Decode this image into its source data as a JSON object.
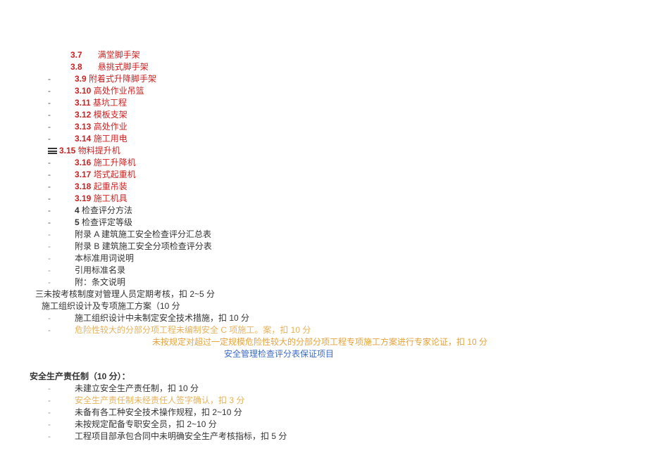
{
  "toc": {
    "r37": {
      "num": "3.7",
      "txt": "满堂脚手架",
      "cls": "red"
    },
    "r38": {
      "num": "3.8",
      "txt": "悬挑式脚手架",
      "cls": "red"
    },
    "r39": {
      "num": "3.9",
      "txt": "附着式升降脚手架",
      "cls": "red"
    },
    "r310": {
      "num": "3.10",
      "txt": "高处作业吊篮",
      "cls": "red"
    },
    "r311": {
      "num": "3.11",
      "txt": "基坑工程",
      "cls": "red"
    },
    "r312": {
      "num": "3.12",
      "txt": "模板支架",
      "cls": "red"
    },
    "r313": {
      "num": "3.13",
      "txt": "高处作业",
      "cls": "red"
    },
    "r314": {
      "num": "3.14",
      "txt": "施工用电",
      "cls": "red"
    },
    "r315": {
      "num": "3.15",
      "txt": "物料提升机",
      "cls": "red"
    },
    "r316": {
      "num": "3.16",
      "txt": "施工升降机",
      "cls": "red"
    },
    "r317": {
      "num": "3.17",
      "txt": "塔式起重机",
      "cls": "red"
    },
    "r318": {
      "num": "3.18",
      "txt": "起重吊装",
      "cls": "red"
    },
    "r319": {
      "num": "3.19",
      "txt": "施工机具",
      "cls": "red"
    },
    "r4": {
      "num": "4",
      "txt": "检查评分方法",
      "cls": ""
    },
    "r5": {
      "num": "5",
      "txt": "检查评定等级",
      "cls": ""
    },
    "appA": {
      "num": "附录 A",
      "txt": "建筑施工安全检查评分汇总表",
      "cls": ""
    },
    "appB": {
      "num": "附录 B",
      "txt": "建筑施工安全分项检查评分表",
      "cls": ""
    },
    "term": {
      "txt": "本标准用词说明"
    },
    "cite": {
      "txt": "引用标准名录"
    },
    "att": {
      "txt": "附：条文说明"
    }
  },
  "body": {
    "line1": "三未按考核制度对管理人员定期考核，扣 2~5 分",
    "line2": "施工组织设计及专项施工方案（10 分",
    "line3": "施工组织设计中未制定安全技术措施，扣 10 分",
    "line4": "危险性较大的分部分项工程未编制安全 C 项施工。案，扣 10 分",
    "line5": "未按规定对超过一定规模危险性较大的分部分项工程专项施工方案进行专家论证，扣 10 分",
    "line6": "安全管理检查评分表保证项目",
    "sec": "安全生产责任制（10 分）：",
    "b1": "未建立安全生产责任制，扣 10 分",
    "b2": "安全生产责任制未经责任人签字确认，扣 3 分",
    "b3": "未备有各工种安全技术操作规程，扣 2~10 分",
    "b4": "未按规定配备专职安全员，扣 2~10 分",
    "b5": "工程项目部承包合同中未明确安全生产考核指标，扣 5 分"
  }
}
